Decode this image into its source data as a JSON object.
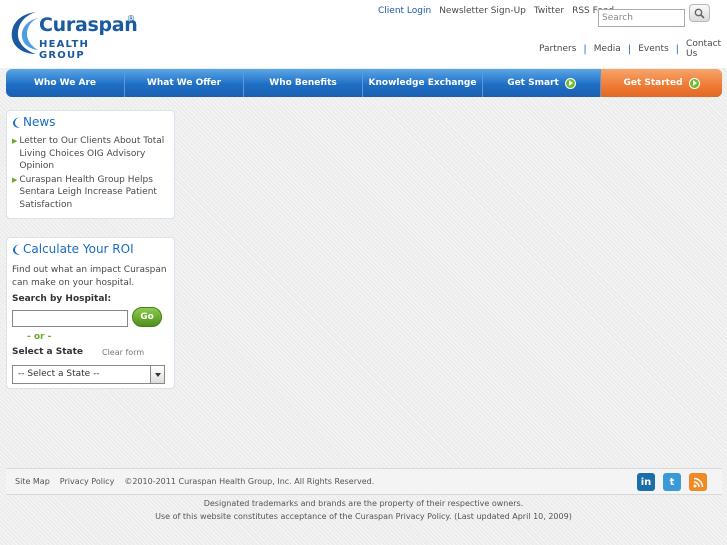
{
  "header": {
    "logo": {
      "name": "Curaspan",
      "registered": "®",
      "subtitle": "HEALTH GROUP"
    },
    "top_links": [
      "Client Login",
      "Newsletter Sign-Up",
      "Twitter",
      "RSS Feed"
    ],
    "search": {
      "placeholder": "Search"
    },
    "sub_links": [
      "Partners",
      "Media",
      "Events",
      "Contact Us"
    ]
  },
  "nav": {
    "items": [
      {
        "label": "Who We Are"
      },
      {
        "label": "What We Offer"
      },
      {
        "label": "Who Benefits"
      },
      {
        "label": "Knowledge Exchange"
      },
      {
        "label": "Get Smart"
      },
      {
        "label": "Get Started"
      }
    ]
  },
  "news": {
    "title": "News",
    "items": [
      "Letter to Our Clients About Total Living Choices OIG Advisory Opinion",
      "Curaspan Health Group Helps Sentara Leigh Increase Patient Satisfaction"
    ]
  },
  "roi": {
    "title": "Calculate Your ROI",
    "description": "Find out what an impact Curaspan can make on your hospital.",
    "search_label": "Search by Hospital:",
    "go_label": "Go",
    "or_label": "- or -",
    "state_label": "Select a State",
    "clear_label": "Clear form",
    "state_selected": "-- Select a State --"
  },
  "footer": {
    "links": [
      "Site Map",
      "Privacy Policy"
    ],
    "copyright": "©2010-2011 Curaspan Health Group, Inc. All Rights Reserved.",
    "social": [
      "linkedin-icon",
      "twitter-icon",
      "rss-icon"
    ],
    "legal_line1": "Designated trademarks and brands are the property of their respective owners.",
    "legal_line2": "Use of this website constitutes acceptance of the Curaspan Privacy Policy. (Last updated April 10, 2009)"
  },
  "colors": {
    "brand_blue": "#1a5aa0",
    "nav_blue": "#1f6fc5",
    "nav_orange": "#ef7a34",
    "accent_green": "#6aaa2c"
  }
}
